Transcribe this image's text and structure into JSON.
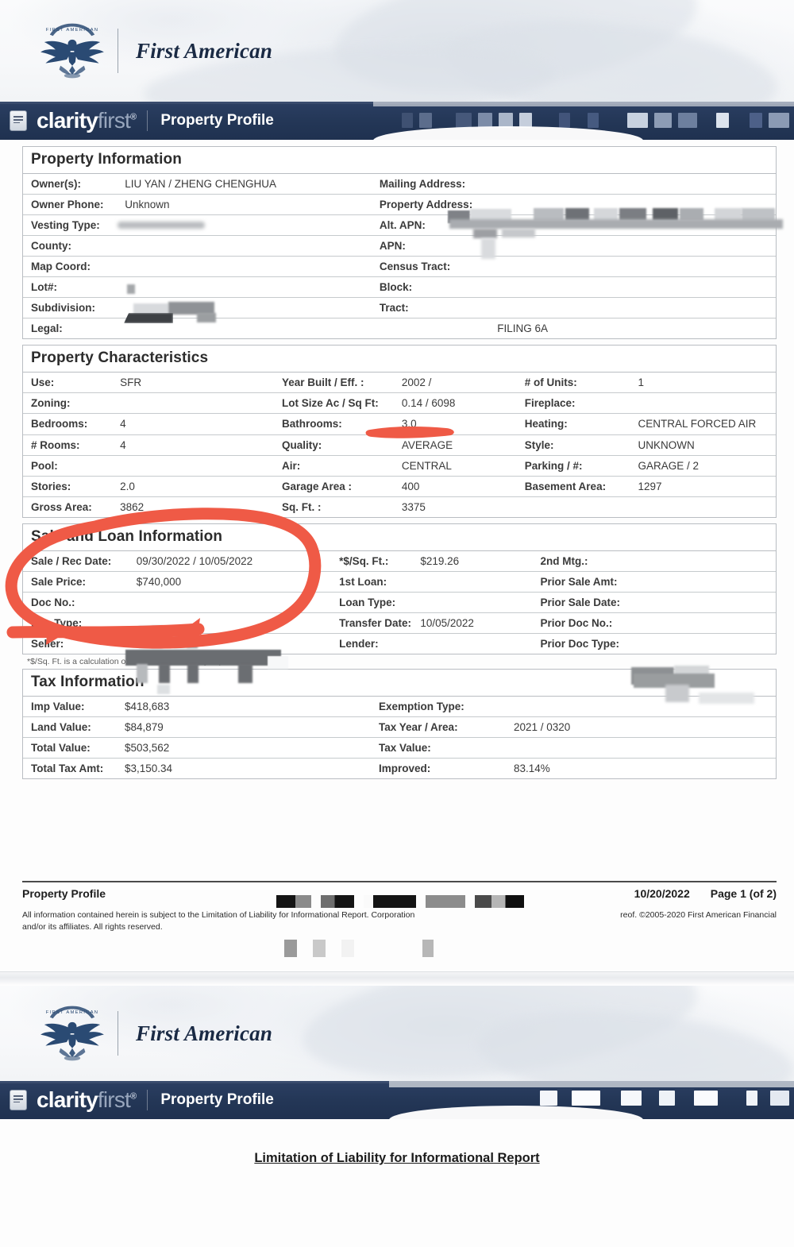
{
  "brand": {
    "company": "First American",
    "eagle_icon": "eagle-logo-icon"
  },
  "appbar": {
    "product_part1": "clarity",
    "product_part2": "first",
    "registered_mark": "®",
    "title": "Property Profile",
    "doc_icon": "document-icon"
  },
  "sections": {
    "property_information": {
      "title": "Property Information",
      "rows": [
        {
          "label1": "Owner(s):",
          "value1": "LIU YAN / ZHENG CHENGHUA",
          "label2": "Mailing Address:",
          "value2": ""
        },
        {
          "label1": "Owner Phone:",
          "value1": "Unknown",
          "label2": "Property Address:",
          "value2": ""
        },
        {
          "label1": "Vesting Type:",
          "value1": "",
          "label2": "Alt. APN:",
          "value2": ""
        },
        {
          "label1": "County:",
          "value1": "",
          "label2": "APN:",
          "value2": ""
        },
        {
          "label1": "Map Coord:",
          "value1": "",
          "label2": "Census Tract:",
          "value2": ""
        },
        {
          "label1": "Lot#:",
          "value1": "",
          "label2": "Block:",
          "value2": ""
        },
        {
          "label1": "Subdivision:",
          "value1": "",
          "label2": "Tract:",
          "value2": ""
        },
        {
          "label1": "Legal:",
          "value1": "",
          "label2": "",
          "value2": "FILING 6A"
        }
      ]
    },
    "property_characteristics": {
      "title": "Property Characteristics",
      "rows": [
        {
          "label1": "Use:",
          "value1": "SFR",
          "label2": "Year Built / Eff. :",
          "value2": "2002 /",
          "label3": "# of Units:",
          "value3": "1"
        },
        {
          "label1": "Zoning:",
          "value1": "",
          "label2": "Lot Size Ac / Sq Ft:",
          "value2": "0.14 / 6098",
          "label3": "Fireplace:",
          "value3": ""
        },
        {
          "label1": "Bedrooms:",
          "value1": "4",
          "label2": "Bathrooms:",
          "value2": "3.0",
          "label3": "Heating:",
          "value3": "CENTRAL FORCED AIR"
        },
        {
          "label1": "# Rooms:",
          "value1": "4",
          "label2": "Quality:",
          "value2": "AVERAGE",
          "label3": "Style:",
          "value3": "UNKNOWN"
        },
        {
          "label1": "Pool:",
          "value1": "",
          "label2": "Air:",
          "value2": "CENTRAL",
          "label3": "Parking / #:",
          "value3": "GARAGE / 2"
        },
        {
          "label1": "Stories:",
          "value1": "2.0",
          "label2": "Garage Area :",
          "value2": "400",
          "label3": "Basement Area:",
          "value3": "1297"
        },
        {
          "label1": "Gross Area:",
          "value1": "3862",
          "label2": "Sq. Ft. :",
          "value2": "3375",
          "label3": "",
          "value3": ""
        }
      ]
    },
    "sale_and_loan": {
      "title": "Sale and Loan Information",
      "rows": [
        {
          "label1": "Sale / Rec Date:",
          "value1": "09/30/2022 / 10/05/2022",
          "label2": "*$/Sq. Ft.:",
          "value2": "$219.26",
          "label3": "2nd Mtg.:",
          "value3": ""
        },
        {
          "label1": "Sale Price:",
          "value1": "$740,000",
          "label2": "1st Loan:",
          "value2": "",
          "label3": "Prior Sale Amt:",
          "value3": ""
        },
        {
          "label1": "Doc No.:",
          "value1": "",
          "label2": "Loan Type:",
          "value2": "",
          "label3": "Prior Sale Date:",
          "value3": ""
        },
        {
          "label1": "Doc Type:",
          "value1": "",
          "label2": "Transfer Date:",
          "value2": "10/05/2022",
          "label3": "Prior Doc No.:",
          "value3": ""
        },
        {
          "label1": "Seller:",
          "value1": "",
          "label2": "Lender:",
          "value2": "",
          "label3": "Prior Doc Type:",
          "value3": ""
        }
      ],
      "footnote": "*$/Sq. Ft. is a calculation of Sale Price divided by Sq. Ft."
    },
    "tax_information": {
      "title": "Tax Information",
      "rows": [
        {
          "label1": "Imp Value:",
          "value1": "$418,683",
          "label2": "Exemption Type:",
          "value2": ""
        },
        {
          "label1": "Land Value:",
          "value1": "$84,879",
          "label2": "Tax Year / Area:",
          "value2": "2021 / 0320"
        },
        {
          "label1": "Total Value:",
          "value1": "$503,562",
          "label2": "Tax Value:",
          "value2": ""
        },
        {
          "label1": "Total Tax Amt:",
          "value1": "$3,150.34",
          "label2": "Improved:",
          "value2": "83.14%"
        }
      ]
    }
  },
  "footer": {
    "report_name": "Property Profile",
    "date": "10/20/2022",
    "page": "Page 1 (of 2)",
    "disclaimer": "All information contained herein is subject to the Limitation of Liability for Informational Report. Corporation and/or its affiliates. All rights reserved.",
    "copyright": "reof. ©2005-2020 First American Financial"
  },
  "page_two": {
    "heading": "Limitation of Liability for Informational Report"
  },
  "annotations": {
    "highlight_color": "#ef5a46",
    "marks": [
      {
        "name": "bathrooms-underline",
        "type": "stroke"
      },
      {
        "name": "sale-loan-circle",
        "type": "circle"
      }
    ]
  }
}
